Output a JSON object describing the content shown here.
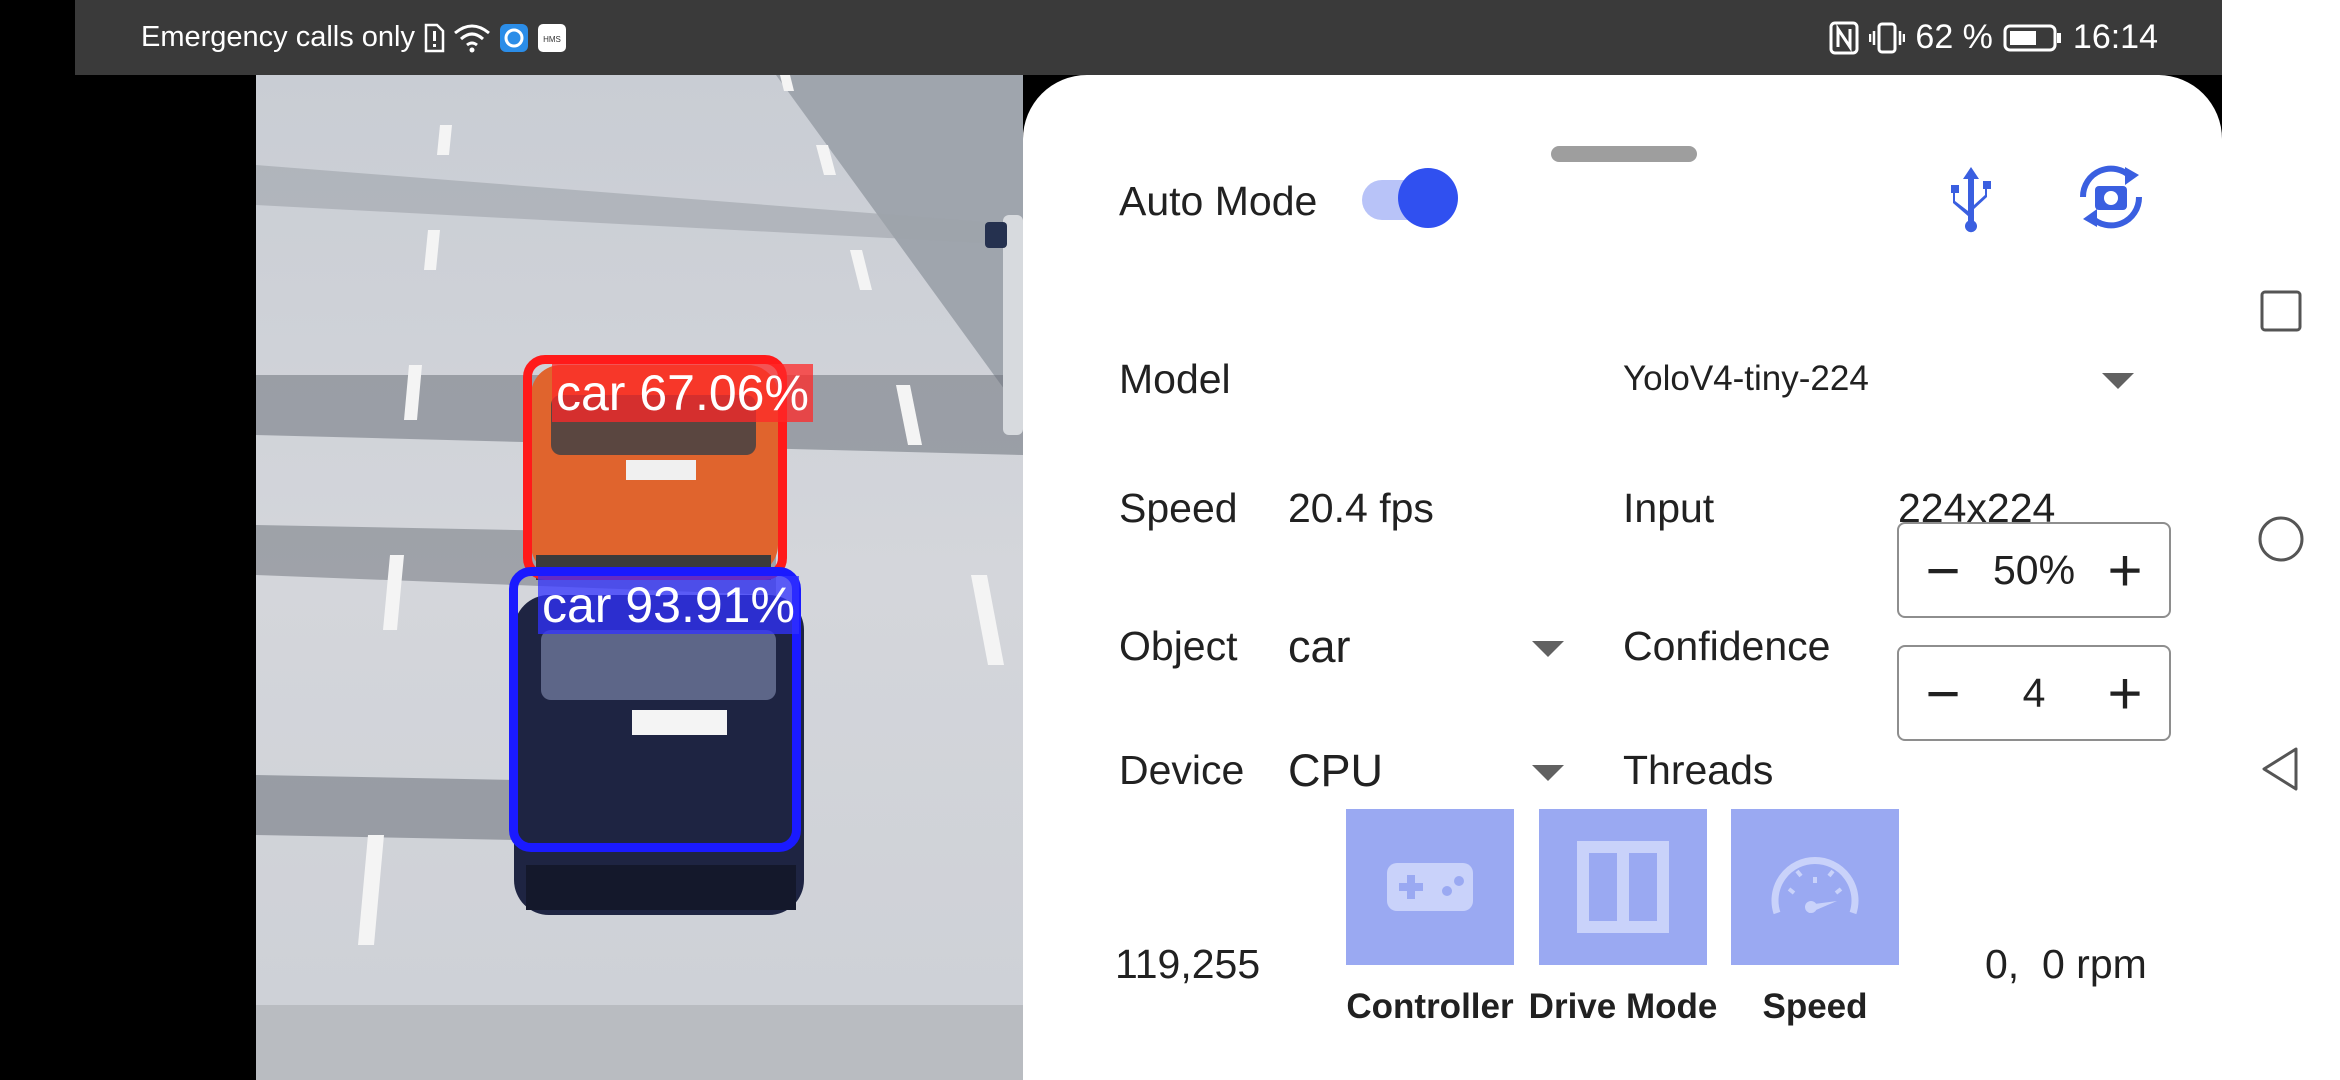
{
  "status_bar": {
    "left_text": "Emergency calls only",
    "icons_left": [
      "sim-alert-icon",
      "wifi-icon",
      "app-notification-icon",
      "hms-icon"
    ],
    "hms_label": "HMS",
    "icons_right": [
      "nfc-icon",
      "vibrate-icon",
      "battery-icon"
    ],
    "battery": "62 %",
    "time": "16:14"
  },
  "camera": {
    "detections": [
      {
        "label": "car 67.06%",
        "color": "#ff1a1a"
      },
      {
        "label": "car 93.91%",
        "color": "#1a1aff"
      }
    ]
  },
  "panel": {
    "auto_mode_label": "Auto Mode",
    "auto_mode_on": true,
    "usb_icon": "usb-icon",
    "switch_camera_icon": "switch-camera-icon",
    "model_label": "Model",
    "model_value": "YoloV4-tiny-224",
    "speed_label": "Speed",
    "speed_value": "20.4 fps",
    "input_label": "Input",
    "input_value": "224x224",
    "object_label": "Object",
    "object_value": "car",
    "confidence_label": "Confidence",
    "confidence_value": "50%",
    "device_label": "Device",
    "device_value": "CPU",
    "threads_label": "Threads",
    "threads_value": "4",
    "stepper_minus": "−",
    "stepper_plus": "+",
    "coords": "119,255",
    "rpm": "0,  0 rpm",
    "buttons": [
      {
        "label": "Controller",
        "icon": "gamepad-icon"
      },
      {
        "label": "Drive Mode",
        "icon": "drive-mode-icon"
      },
      {
        "label": "Speed",
        "icon": "speedometer-icon"
      }
    ],
    "accent_color": "#3050f0",
    "button_color": "#9aa9f2"
  },
  "nav": {
    "icons": [
      "recent-apps-icon",
      "home-icon",
      "back-icon"
    ]
  }
}
